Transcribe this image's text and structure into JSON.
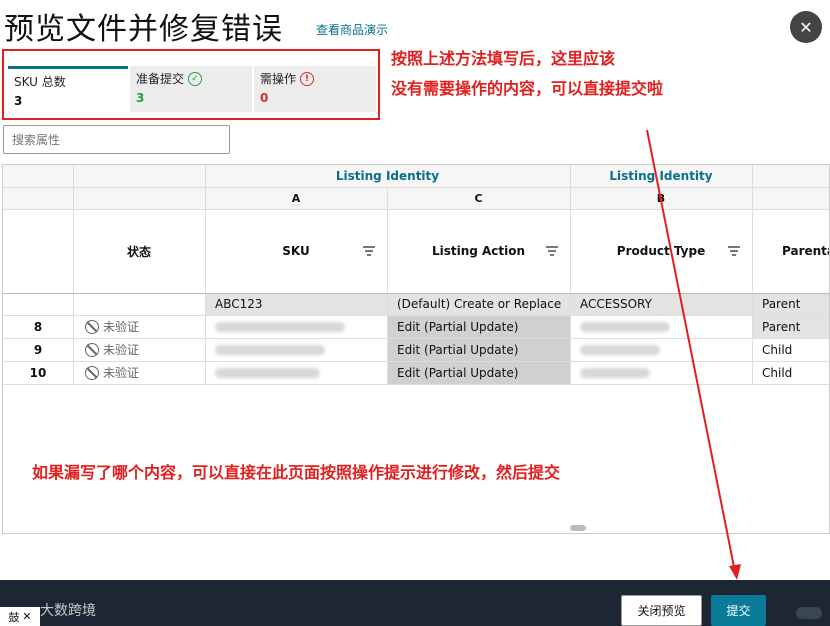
{
  "page": {
    "title": "预览文件并修复错误",
    "demo_link": "查看商品演示"
  },
  "summary": {
    "total_label": "SKU 总数",
    "total_value": "3",
    "ready_label": "准备提交",
    "ready_value": "3",
    "action_label": "需操作",
    "action_value": "0"
  },
  "annotations": {
    "top_line1": "按照上述方法填写后，这里应该",
    "top_line2": "没有需要操作的内容，可以直接提交啦",
    "bottom": "如果漏写了哪个内容，可以直接在此页面按照操作提示进行修改，然后提交"
  },
  "search": {
    "placeholder": "搜索属性"
  },
  "table": {
    "group_headers": [
      "Listing Identity",
      "Listing Identity"
    ],
    "column_letters": [
      "A",
      "C",
      "B"
    ],
    "status_header": "状态",
    "columns": [
      "SKU",
      "Listing Action",
      "Product Type",
      "Parenta"
    ],
    "default_row": {
      "sku": "ABC123",
      "action": "(Default) Create or Replace",
      "product_type": "ACCESSORY",
      "parentage": "Parent"
    },
    "rows": [
      {
        "num": "8",
        "status": "未验证",
        "action": "Edit (Partial Update)",
        "parentage": "Parent"
      },
      {
        "num": "9",
        "status": "未验证",
        "action": "Edit (Partial Update)",
        "parentage": "Child"
      },
      {
        "num": "10",
        "status": "未验证",
        "action": "Edit (Partial Update)",
        "parentage": "Child"
      }
    ]
  },
  "footer": {
    "watermark": "大数跨境",
    "tab_chip": "鼓",
    "close_preview": "关闭预览",
    "submit": "提交"
  },
  "colors": {
    "accent": "#0a7c99",
    "annotation": "#e02020",
    "ready": "#2d9b3f",
    "action_needed": "#d32f2f"
  }
}
